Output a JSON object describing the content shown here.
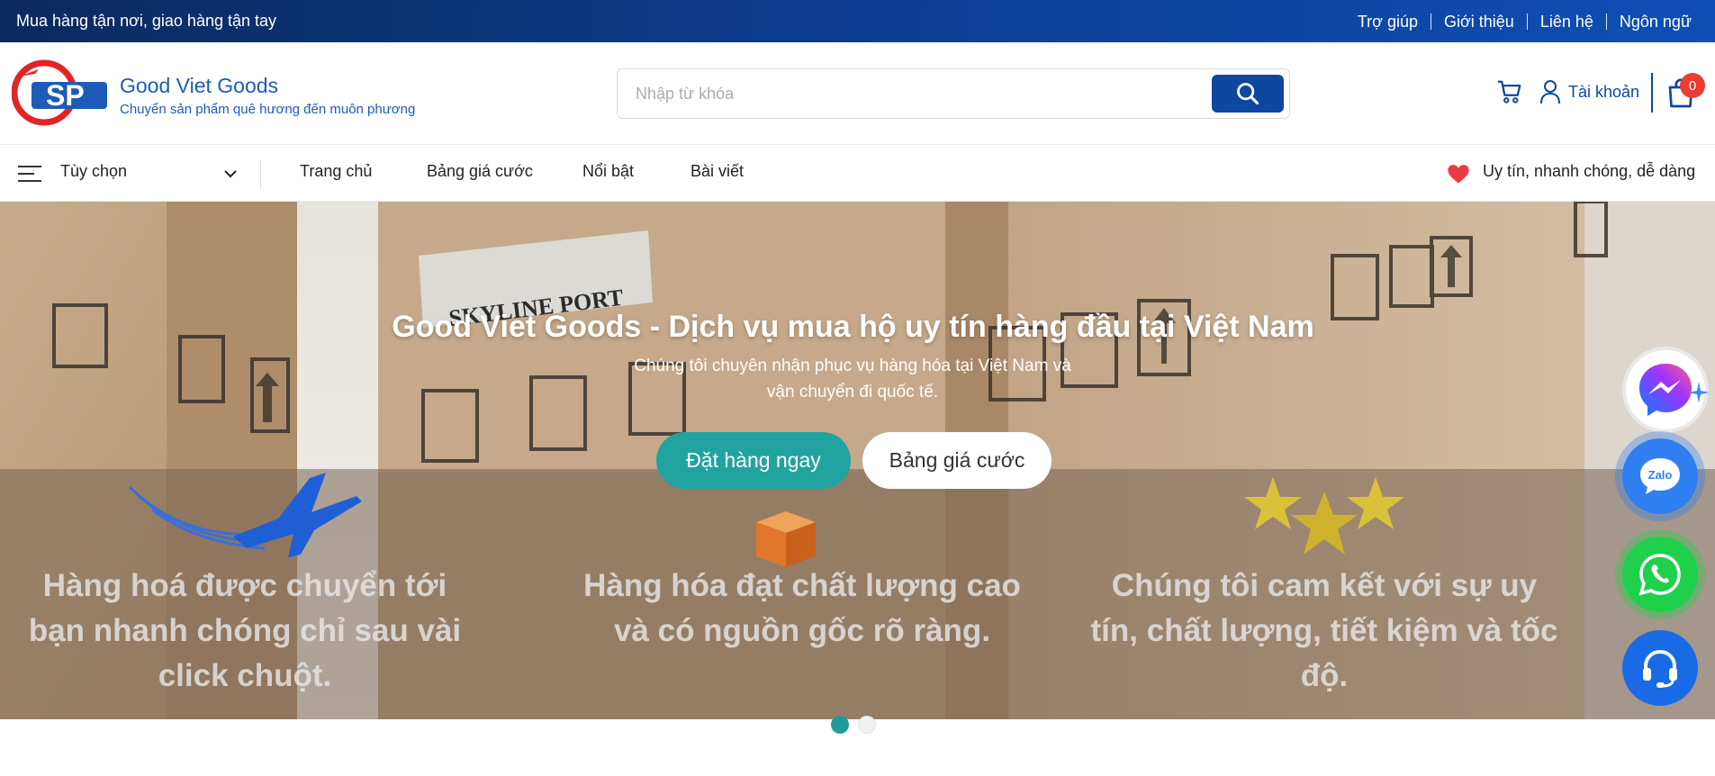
{
  "topbar": {
    "tagline": "Mua hàng tận nơi, giao hàng tận tay",
    "links": [
      "Trợ giúp",
      "Giới thiệu",
      "Liên hệ",
      "Ngôn ngữ"
    ]
  },
  "header": {
    "brand_name": "Good Viet Goods",
    "brand_tagline": "Chuyển sản phẩm quê hương đến muôn phương",
    "logo_letters": "SP",
    "search_placeholder": "Nhập từ khóa",
    "account_label": "Tài khoản",
    "cart_count": "0"
  },
  "nav": {
    "select_label": "Tùy chọn",
    "links": [
      "Trang chủ",
      "Bảng giá cước",
      "Nổi bật",
      "Bài viết"
    ],
    "slogan": "Uy tín, nhanh chóng, dễ dàng"
  },
  "hero": {
    "title": "Good Viet Goods - Dịch vụ mua hộ uy tín hàng đầu tại Việt Nam",
    "subtitle": "Chúng tôi chuyên nhận phục vụ hàng hóa tại Việt Nam và vận chuyển đi quốc tế.",
    "order_button": "Đặt hàng ngay",
    "price_button": "Bảng giá cước",
    "box_label": "SKYLINE PORT",
    "features": [
      "Hàng hoá được chuyển tới bạn nhanh chóng chỉ sau vài click chuột.",
      "Hàng hóa đạt chất lượng cao và có nguồn gốc rõ ràng.",
      "Chúng tôi cam kết với sự uy tín, chất lượng, tiết kiệm và tốc độ."
    ],
    "slides_total": 2,
    "active_slide": 1
  },
  "floating": {
    "zalo_label": "Zalo",
    "icons": [
      "messenger-icon",
      "zalo-icon",
      "whatsapp-icon",
      "headset-icon"
    ]
  },
  "colors": {
    "topbar": "#0b2a5e",
    "brand": "#1d5bb8",
    "primary": "#0d47a1",
    "accent_teal": "#21a3a0",
    "badge_red": "#ea3d33"
  }
}
